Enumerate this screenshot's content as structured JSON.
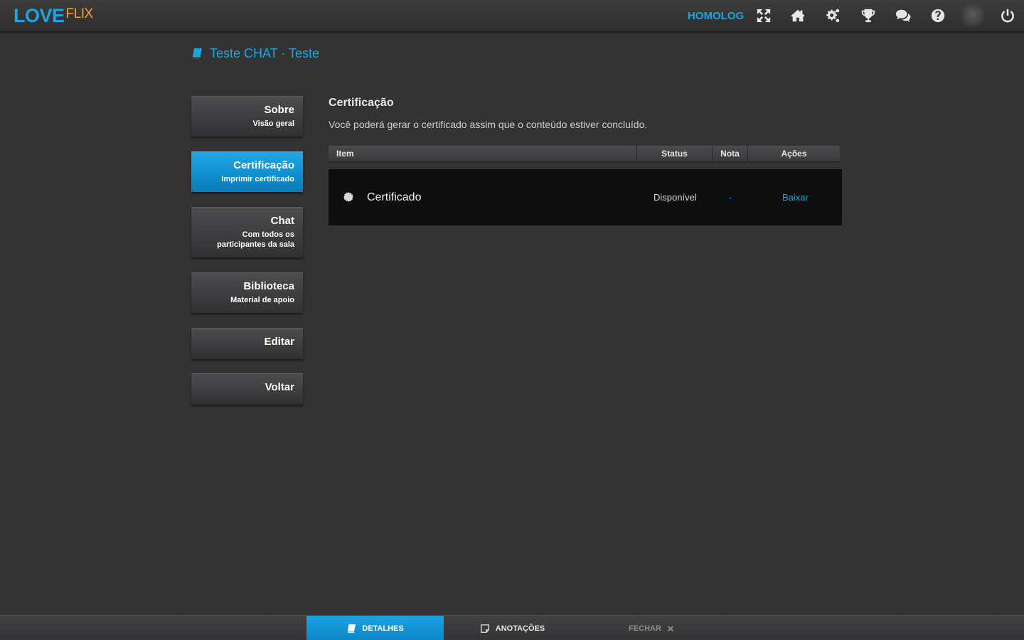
{
  "header": {
    "logo_primary": "LOVE",
    "logo_secondary": "FLIX",
    "environment": "HOMOLOG",
    "icons": [
      "fullscreen-icon",
      "home-icon",
      "settings-icon",
      "trophy-icon",
      "chat-icon",
      "help-icon",
      "avatar",
      "power-icon"
    ]
  },
  "breadcrumb": {
    "icon": "book-icon",
    "text": "Teste CHAT · Teste"
  },
  "sidebar": {
    "items": [
      {
        "title": "Sobre",
        "subtitle": "Visão geral",
        "active": false
      },
      {
        "title": "Certificação",
        "subtitle": "Imprimir certificado",
        "active": true
      },
      {
        "title": "Chat",
        "subtitle": "Com todos os participantes da sala",
        "active": false
      },
      {
        "title": "Biblioteca",
        "subtitle": "Material de apoio",
        "active": false
      },
      {
        "title": "Editar",
        "subtitle": "",
        "active": false
      },
      {
        "title": "Voltar",
        "subtitle": "",
        "active": false
      }
    ]
  },
  "main": {
    "title": "Certificação",
    "description": "Você poderá gerar o certificado assim que o conteúdo estiver concluído.",
    "table": {
      "columns": [
        "Item",
        "Status",
        "Nota",
        "Ações"
      ],
      "rows": [
        {
          "item": "Certificado",
          "status": "Disponível",
          "nota": "-",
          "acao": "Baixar"
        }
      ]
    }
  },
  "footer": {
    "tabs": [
      {
        "label": "DETALHES",
        "icon": "book-icon",
        "active": true
      },
      {
        "label": "ANOTAÇÕES",
        "icon": "note-icon",
        "active": false
      }
    ],
    "close_label": "FECHAR"
  },
  "colors": {
    "accent": "#1aa6e0",
    "logo_secondary": "#f2a12e",
    "background": "#333334",
    "row_background": "#0f0e0f"
  }
}
